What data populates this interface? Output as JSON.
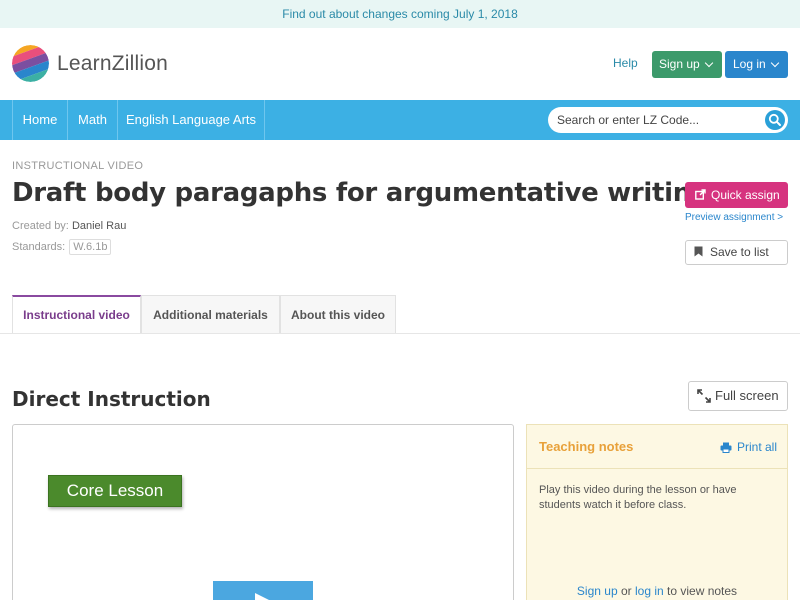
{
  "announcement": "Find out about changes coming July 1, 2018",
  "header": {
    "logo_text": "LearnZillion",
    "help": "Help",
    "signup": "Sign up",
    "login": "Log in"
  },
  "nav": {
    "items": [
      "Home",
      "Math",
      "English Language Arts"
    ],
    "search_placeholder": "Search or enter LZ Code..."
  },
  "lesson": {
    "eyebrow": "INSTRUCTIONAL VIDEO",
    "title": "Draft body paragaphs for argumentative writing",
    "created_label": "Created by:",
    "author": "Daniel Rau",
    "standards_label": "Standards:",
    "standard": "W.6.1b"
  },
  "actions": {
    "quick_assign": "Quick assign",
    "preview": "Preview assignment >",
    "save": "Save to list"
  },
  "tabs": [
    "Instructional video",
    "Additional materials",
    "About this video"
  ],
  "section": {
    "title": "Direct Instruction",
    "full_screen": "Full screen"
  },
  "video": {
    "slide_label": "Core Lesson"
  },
  "notes": {
    "title": "Teaching notes",
    "print": "Print all",
    "body": "Play this video during the lesson or have students watch it before class.",
    "footer_signup": "Sign up",
    "footer_or": "or",
    "footer_login": "log in",
    "footer_rest": "to view notes"
  },
  "colors": {
    "nav_blue": "#3cb0e4",
    "signup_green": "#3c9a6b",
    "login_blue": "#2a86cc",
    "quick_assign_pink": "#d6337f",
    "notes_bg": "#fdf8e3",
    "notes_title": "#e8a13a",
    "tab_active": "#8a4aa0"
  }
}
